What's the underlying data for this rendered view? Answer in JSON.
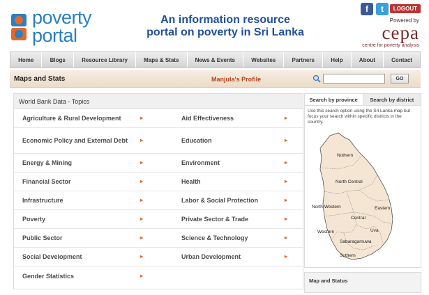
{
  "logo": {
    "line1": "poverty",
    "line2": "portal",
    "icon": "poverty-portal-logo"
  },
  "tagline": "An information resource portal on poverty in Sri Lanka",
  "header": {
    "logout_label": "LOGOUT",
    "powered_by": "Powered by",
    "cepa_logo": "cepa",
    "cepa_sub": "centre for poverty analysis",
    "social_icons": [
      "facebook-icon",
      "twitter-icon"
    ]
  },
  "nav": [
    "Home",
    "Blogs",
    "Resource Library",
    "Maps & Stats",
    "News & Events",
    "Websites",
    "Partners",
    "Help",
    "About",
    "Contact"
  ],
  "subbar": {
    "title": "Maps and Stats",
    "profile_link": "Manjula's Profile",
    "search_placeholder": "",
    "go_label": "GO"
  },
  "topics": {
    "heading": "World Bank Data - Topics",
    "items": [
      "Agriculture & Rural Development",
      "Aid Effectiveness",
      "Economic Policy and External Debt",
      "Education",
      "Energy & Mining",
      "Environment",
      "Financial Sector",
      "Health",
      "Infrastructure",
      "Labor & Social Protection",
      "Poverty",
      "Private Sector & Trade",
      "Public Sector",
      "Science & Technology",
      "Social Development",
      "Urban Development",
      "Gender Statistics",
      ""
    ],
    "arrow": "▸"
  },
  "rightpanel": {
    "tabs": [
      "Search by province",
      "Search by district"
    ],
    "active_tab": 0,
    "help": "Use this search option using the Sri Lanka map but focus your search within specific districts in the country.",
    "provinces": [
      "Nothern",
      "North Central",
      "North Western",
      "Eastern",
      "Central",
      "Western",
      "Uva",
      "Sabaragamuwa",
      "Suthern"
    ],
    "map_fill": "#f5e6d3",
    "map_stroke": "#555555"
  },
  "mapstatus": {
    "title": "Map and Status"
  },
  "colors": {
    "accent": "#e4682a",
    "brand_blue": "#2b7fc2",
    "title_blue": "#1f4f9a",
    "profile": "#b6421a"
  }
}
